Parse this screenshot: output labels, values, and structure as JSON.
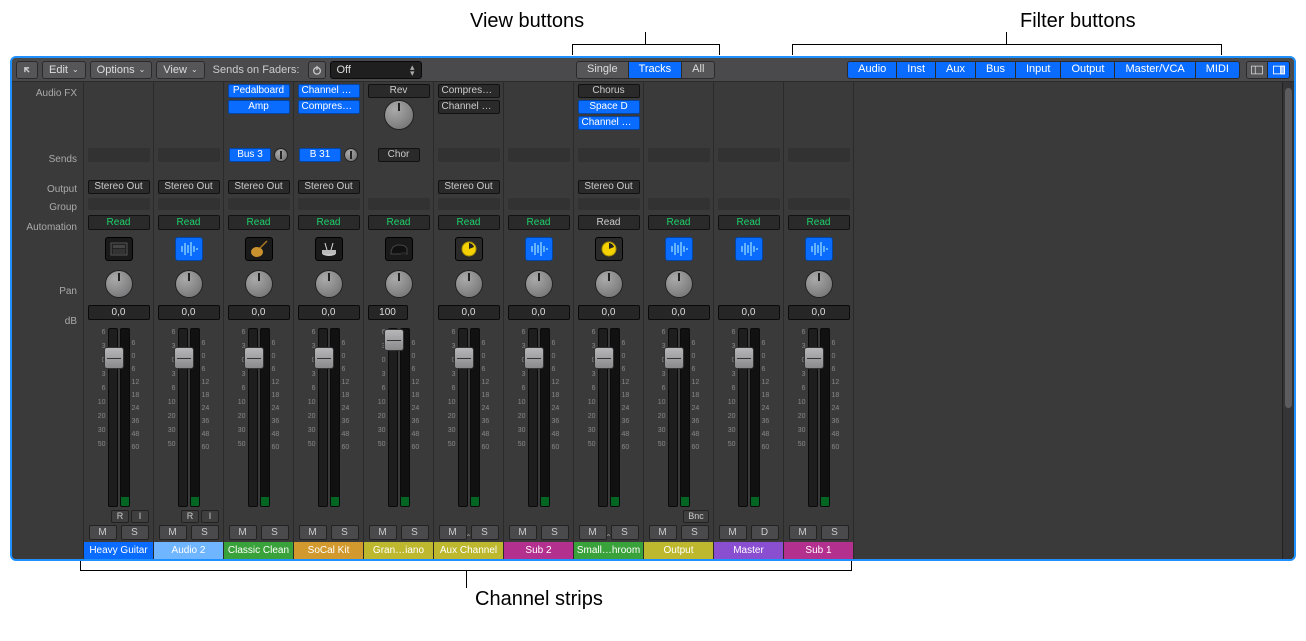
{
  "callouts": {
    "view": "View buttons",
    "filter": "Filter buttons",
    "channels": "Channel strips"
  },
  "toolbar": {
    "menus": [
      "Edit",
      "Options",
      "View"
    ],
    "sends_on_faders_label": "Sends on Faders:",
    "sends_on_faders_value": "Off",
    "view_buttons": [
      "Single",
      "Tracks",
      "All"
    ],
    "view_active": "Tracks",
    "filter_buttons": [
      "Audio",
      "Inst",
      "Aux",
      "Bus",
      "Input",
      "Output",
      "Master/VCA",
      "MIDI"
    ]
  },
  "row_labels": {
    "audio_fx": "Audio FX",
    "sends": "Sends",
    "output": "Output",
    "group": "Group",
    "automation": "Automation",
    "pan": "Pan",
    "db": "dB"
  },
  "common": {
    "mute": "M",
    "solo": "S",
    "dim": "D",
    "rec": "R",
    "input_mon": "I",
    "bnc": "Bnc",
    "read": "Read",
    "stereo_out": "Stereo Out"
  },
  "fader_scale_left": [
    "6",
    "3",
    "0",
    "3",
    "6",
    "10",
    "20",
    "30",
    "50"
  ],
  "fader_scale_right": [
    "",
    "6",
    "0",
    "6",
    "12",
    "18",
    "24",
    "36",
    "48",
    "60"
  ],
  "colors": {
    "blue": "#0a6cff",
    "audio_blue": "#0a6cff",
    "pale_blue": "#6fb5ff",
    "green": "#3aa23a",
    "orange": "#d29a2e",
    "yellow": "#bdb82e",
    "magenta": "#b4308f",
    "purple": "#8a4ed0"
  },
  "strips": [
    {
      "name": "Heavy Guitar",
      "color_key": "audio_blue",
      "db": "0,0",
      "fader_pos": 0.1,
      "output": "Stereo Out",
      "read": "Read",
      "read_style": "green",
      "icon": "amp",
      "rec": true,
      "ms": [
        "M",
        "S"
      ]
    },
    {
      "name": "Audio 2",
      "color_key": "pale_blue",
      "db": "0,0",
      "fader_pos": 0.1,
      "output": "Stereo Out",
      "read": "Read",
      "read_style": "green",
      "icon": "wave",
      "rec": true,
      "ms": [
        "M",
        "S"
      ]
    },
    {
      "name": "Classic Clean",
      "color_key": "green",
      "db": "0,0",
      "fader_pos": 0.1,
      "fx": [
        {
          "label": "Pedalboard",
          "style": "blue"
        },
        {
          "label": "Amp",
          "style": "blue"
        }
      ],
      "sends": [
        {
          "label": "Bus 3",
          "style": "blue",
          "knob": true
        }
      ],
      "output": "Stereo Out",
      "read": "Read",
      "read_style": "green",
      "icon": "guitar",
      "ms": [
        "M",
        "S"
      ]
    },
    {
      "name": "SoCal Kit",
      "color_key": "orange",
      "db": "0,0",
      "fader_pos": 0.1,
      "fx": [
        {
          "label": "Channel EQ",
          "style": "blue"
        },
        {
          "label": "Compressor",
          "style": "blue"
        }
      ],
      "sends": [
        {
          "label": "B 31",
          "style": "blue",
          "knob": true
        }
      ],
      "output": "Stereo Out",
      "read": "Read",
      "read_style": "green",
      "icon": "drums",
      "ms": [
        "M",
        "S"
      ]
    },
    {
      "name": "Gran…iano",
      "color_key": "yellow",
      "db": "100",
      "db_extra": true,
      "fader_pos": 0.0,
      "fx": [
        {
          "label": "Rev",
          "style": "gray",
          "knob_after": true
        }
      ],
      "sends": [
        {
          "label": "Chor",
          "style": "gray",
          "knob_after": true
        }
      ],
      "read": "Read",
      "read_style": "green",
      "icon": "piano",
      "ms": [
        "M",
        "S"
      ]
    },
    {
      "name": "Aux Channel",
      "color_key": "yellow",
      "db": "0,0",
      "fader_pos": 0.1,
      "fx": [
        {
          "label": "Compressor",
          "style": "gray"
        },
        {
          "label": "Channel EQ",
          "style": "gray"
        }
      ],
      "output": "Stereo Out",
      "read": "Read",
      "read_style": "green",
      "icon": "disc",
      "ms": [
        "M",
        "S"
      ],
      "expand": true
    },
    {
      "name": "Sub 2",
      "color_key": "magenta",
      "db": "0,0",
      "fader_pos": 0.1,
      "read": "Read",
      "read_style": "green",
      "icon": "wave",
      "ms": [
        "M",
        "S"
      ]
    },
    {
      "name": "Small…hroom",
      "color_key": "green",
      "db": "0,0",
      "fader_pos": 0.1,
      "fx": [
        {
          "label": "Chorus",
          "style": "gray"
        },
        {
          "label": "Space D",
          "style": "blue"
        },
        {
          "label": "Channel EQ",
          "style": "blue"
        }
      ],
      "output": "Stereo Out",
      "read": "Read",
      "read_style": "gray",
      "icon": "disc",
      "ms": [
        "M",
        "S"
      ],
      "expand": true
    },
    {
      "name": "Output",
      "color_key": "yellow",
      "db": "0,0",
      "fader_pos": 0.1,
      "read": "Read",
      "read_style": "green",
      "icon": "wave",
      "bnc": true,
      "ms": [
        "M",
        "S"
      ]
    },
    {
      "name": "Master",
      "color_key": "purple",
      "db": "0,0",
      "fader_pos": 0.1,
      "read": "Read",
      "read_style": "green",
      "icon": "wave",
      "ms": [
        "M",
        "D"
      ],
      "no_pan": true
    },
    {
      "name": "Sub 1",
      "color_key": "magenta",
      "db": "0,0",
      "fader_pos": 0.1,
      "read": "Read",
      "read_style": "green",
      "icon": "wave",
      "ms": [
        "M",
        "S"
      ]
    }
  ]
}
